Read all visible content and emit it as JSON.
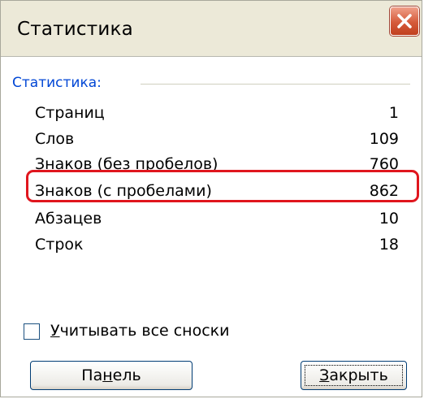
{
  "window": {
    "title": "Статистика",
    "close_icon": "close-icon",
    "close_color": "#d55a3a"
  },
  "group": {
    "label": "Статистика:",
    "label_color": "#0046d5"
  },
  "stats": [
    {
      "label": "Страниц",
      "value": "1"
    },
    {
      "label": "Слов",
      "value": "109"
    },
    {
      "label": "Знаков (без пробелов)",
      "value": "760"
    },
    {
      "label": "Знаков (с пробелами)",
      "value": "862"
    },
    {
      "label": "Абзацев",
      "value": "10"
    },
    {
      "label": "Строк",
      "value": "18"
    }
  ],
  "highlight_color": "#e0161e",
  "checkbox": {
    "label_first": "У",
    "label_rest": "читывать все сноски",
    "checked": false
  },
  "buttons": {
    "panel_pre": "Па",
    "panel_ul": "н",
    "panel_post": "ель",
    "close_ul": "З",
    "close_post": "акрыть"
  }
}
